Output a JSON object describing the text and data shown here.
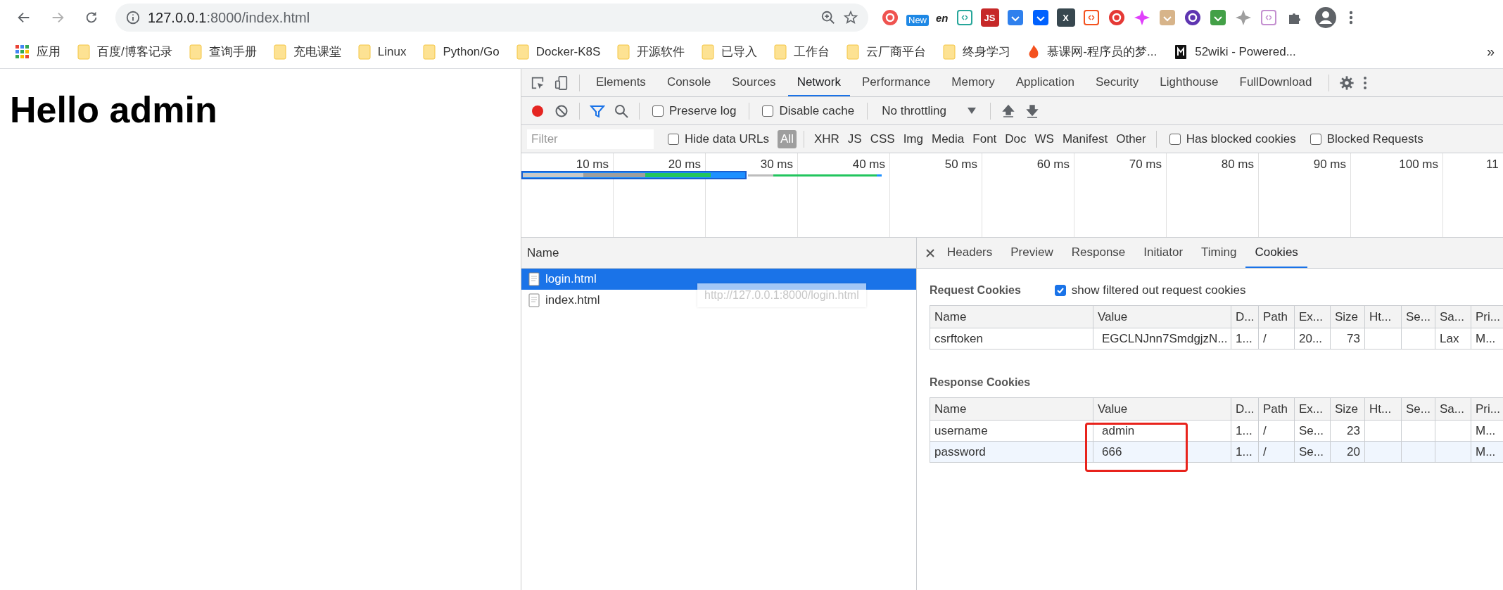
{
  "browser": {
    "url_host": "127.0.0.1",
    "url_path": ":8000/index.html",
    "extensions": [
      {
        "kind": "ring",
        "color": "#ef5350"
      },
      {
        "kind": "badge",
        "color": "#1e88e5",
        "label": "New"
      },
      {
        "kind": "text",
        "color": "#222222",
        "label": "en"
      },
      {
        "kind": "outline",
        "color": "#26a69a"
      },
      {
        "kind": "tile",
        "color": "#c62828",
        "label": "JS"
      },
      {
        "kind": "tile",
        "color": "#2f80ed"
      },
      {
        "kind": "tile",
        "color": "#0061fe"
      },
      {
        "kind": "tile",
        "color": "#37474f",
        "label": "X"
      },
      {
        "kind": "outline",
        "color": "#f4511e"
      },
      {
        "kind": "ring",
        "color": "#e53935"
      },
      {
        "kind": "star",
        "color": "#e040fb"
      },
      {
        "kind": "tile",
        "color": "#d7b48a"
      },
      {
        "kind": "ring",
        "color": "#5e35b1"
      },
      {
        "kind": "tile",
        "color": "#43a047"
      },
      {
        "kind": "star",
        "color": "#9e9e9e"
      },
      {
        "kind": "outline",
        "color": "#c48fd0"
      }
    ]
  },
  "bookmarks": [
    {
      "kind": "apps",
      "label": "应用"
    },
    {
      "kind": "folder",
      "label": "百度/博客记录"
    },
    {
      "kind": "folder",
      "label": "查询手册"
    },
    {
      "kind": "folder",
      "label": "充电课堂"
    },
    {
      "kind": "folder",
      "label": "Linux"
    },
    {
      "kind": "folder",
      "label": "Python/Go"
    },
    {
      "kind": "folder",
      "label": "Docker-K8S"
    },
    {
      "kind": "folder",
      "label": "开源软件"
    },
    {
      "kind": "folder",
      "label": "已导入"
    },
    {
      "kind": "folder",
      "label": "工作台"
    },
    {
      "kind": "folder",
      "label": "云厂商平台"
    },
    {
      "kind": "folder",
      "label": "终身学习"
    },
    {
      "kind": "fire",
      "label": "慕课网-程序员的梦..."
    },
    {
      "kind": "wiki",
      "label": "52wiki - Powered..."
    }
  ],
  "bookmarks_more": "»",
  "page": {
    "heading": "Hello admin"
  },
  "devtools": {
    "tabs": [
      {
        "label": "Elements",
        "selected": false
      },
      {
        "label": "Console",
        "selected": false
      },
      {
        "label": "Sources",
        "selected": false
      },
      {
        "label": "Network",
        "selected": true
      },
      {
        "label": "Performance",
        "selected": false
      },
      {
        "label": "Memory",
        "selected": false
      },
      {
        "label": "Application",
        "selected": false
      },
      {
        "label": "Security",
        "selected": false
      },
      {
        "label": "Lighthouse",
        "selected": false
      },
      {
        "label": "FullDownload",
        "selected": false
      }
    ],
    "recording": true,
    "filter_active": true,
    "preserve_log": {
      "label": "Preserve log",
      "checked": false
    },
    "disable_cache": {
      "label": "Disable cache",
      "checked": false
    },
    "throttling": "No throttling",
    "filter_placeholder": "Filter",
    "hide_data_urls": {
      "label": "Hide data URLs",
      "checked": false
    },
    "types": [
      {
        "label": "All",
        "selected": true
      },
      {
        "label": "XHR",
        "selected": false
      },
      {
        "label": "JS",
        "selected": false
      },
      {
        "label": "CSS",
        "selected": false
      },
      {
        "label": "Img",
        "selected": false
      },
      {
        "label": "Media",
        "selected": false
      },
      {
        "label": "Font",
        "selected": false
      },
      {
        "label": "Doc",
        "selected": false
      },
      {
        "label": "WS",
        "selected": false
      },
      {
        "label": "Manifest",
        "selected": false
      },
      {
        "label": "Other",
        "selected": false
      }
    ],
    "has_blocked_cookies": {
      "label": "Has blocked cookies",
      "checked": false
    },
    "blocked_requests": {
      "label": "Blocked Requests",
      "checked": false
    },
    "timeline_ticks": [
      "10 ms",
      "20 ms",
      "30 ms",
      "40 ms",
      "50 ms",
      "60 ms",
      "70 ms",
      "80 ms",
      "90 ms",
      "100 ms",
      "11"
    ],
    "name_header": "Name",
    "requests": [
      {
        "name": "login.html",
        "selected": true
      },
      {
        "name": "index.html",
        "selected": false
      }
    ],
    "tooltip": "http://127.0.0.1:8000/login.html",
    "detail_tabs": [
      {
        "label": "Headers",
        "selected": false
      },
      {
        "label": "Preview",
        "selected": false
      },
      {
        "label": "Response",
        "selected": false
      },
      {
        "label": "Initiator",
        "selected": false
      },
      {
        "label": "Timing",
        "selected": false
      },
      {
        "label": "Cookies",
        "selected": true
      }
    ],
    "request_cookies": {
      "title": "Request Cookies",
      "show_filtered": {
        "label": "show filtered out request cookies",
        "checked": true
      },
      "columns": [
        "Name",
        "Value",
        "D...",
        "Path",
        "Ex...",
        "Size",
        "Ht...",
        "Se...",
        "Sa...",
        "Pri..."
      ],
      "rows": [
        [
          "csrftoken",
          "EGCLNJnn7SmdgjzN...",
          "1...",
          "/",
          "20...",
          "73",
          null,
          null,
          "Lax",
          "M..."
        ]
      ]
    },
    "response_cookies": {
      "title": "Response Cookies",
      "columns": [
        "Name",
        "Value",
        "D...",
        "Path",
        "Ex...",
        "Size",
        "Ht...",
        "Se...",
        "Sa...",
        "Pri..."
      ],
      "rows": [
        [
          "username",
          "admin",
          "1...",
          "/",
          "Se...",
          "23",
          null,
          null,
          null,
          "M..."
        ],
        [
          "password",
          "666",
          "1...",
          "/",
          "Se...",
          "20",
          null,
          null,
          null,
          "M..."
        ]
      ]
    }
  }
}
